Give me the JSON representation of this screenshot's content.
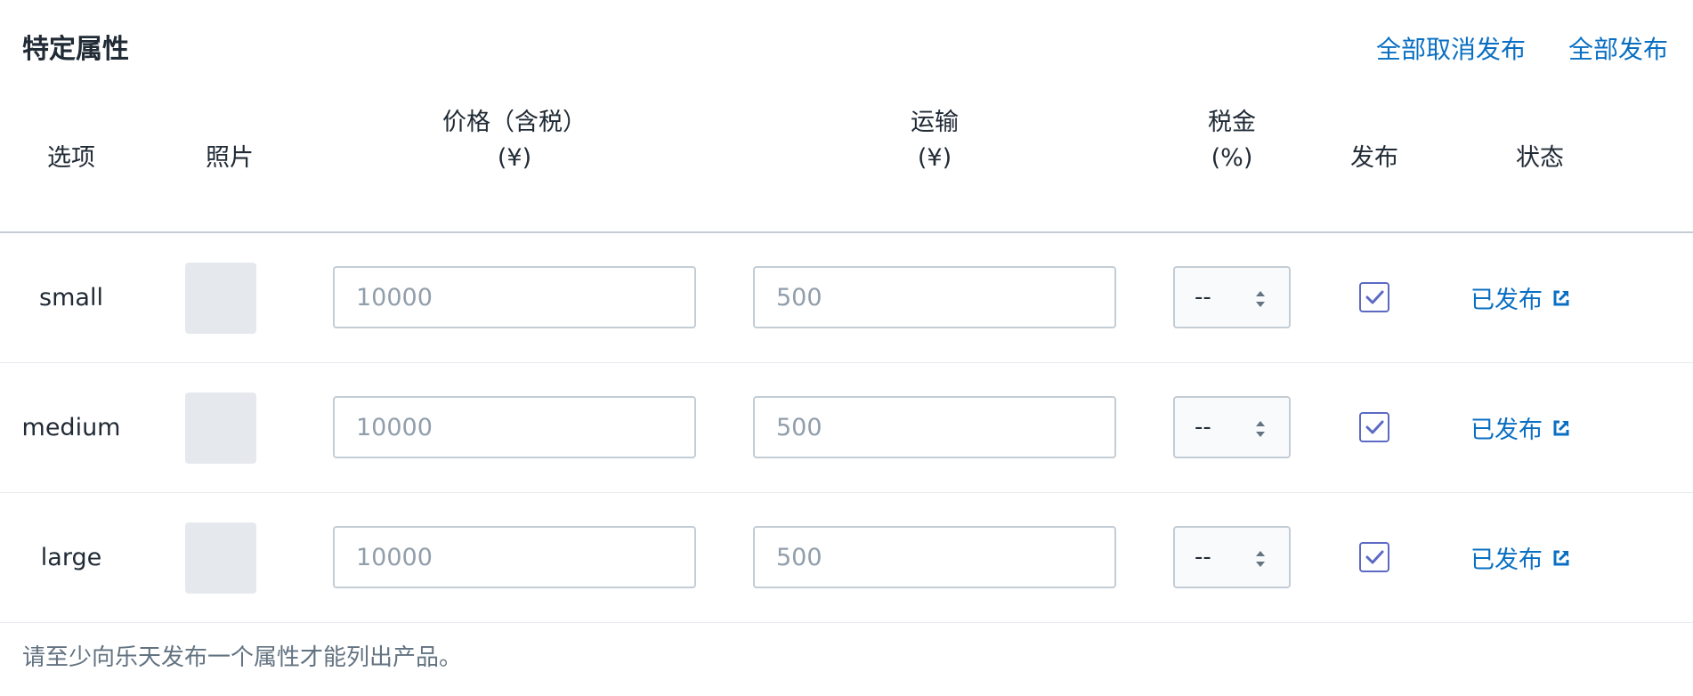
{
  "section": {
    "title": "特定属性",
    "actions": {
      "unpublish_all": "全部取消发布",
      "publish_all": "全部发布"
    }
  },
  "table": {
    "headers": {
      "option": "选项",
      "photo": "照片",
      "price_line1": "价格（含税）",
      "price_line2": "(¥)",
      "shipping_line1": "运输",
      "shipping_line2": "(¥)",
      "tax_line1": "税金",
      "tax_line2": "(%)",
      "publish": "发布",
      "status": "状态"
    },
    "rows": [
      {
        "option": "small",
        "price_placeholder": "10000",
        "shipping_placeholder": "500",
        "tax": "--",
        "published": true,
        "status": "已发布"
      },
      {
        "option": "medium",
        "price_placeholder": "10000",
        "shipping_placeholder": "500",
        "tax": "--",
        "published": true,
        "status": "已发布"
      },
      {
        "option": "large",
        "price_placeholder": "10000",
        "shipping_placeholder": "500",
        "tax": "--",
        "published": true,
        "status": "已发布"
      }
    ]
  },
  "footer": {
    "note": "请至少向乐天发布一个属性才能列出产品。"
  },
  "icons": {
    "status_link": "external-link-icon",
    "publish": "checkmark-icon",
    "tax_select": "select-stepper-icon"
  },
  "colors": {
    "link": "#0a6fc2",
    "checkbox": "#5c6ac4",
    "border": "#c4cdd5",
    "photo_placeholder": "#e5e8ec"
  }
}
